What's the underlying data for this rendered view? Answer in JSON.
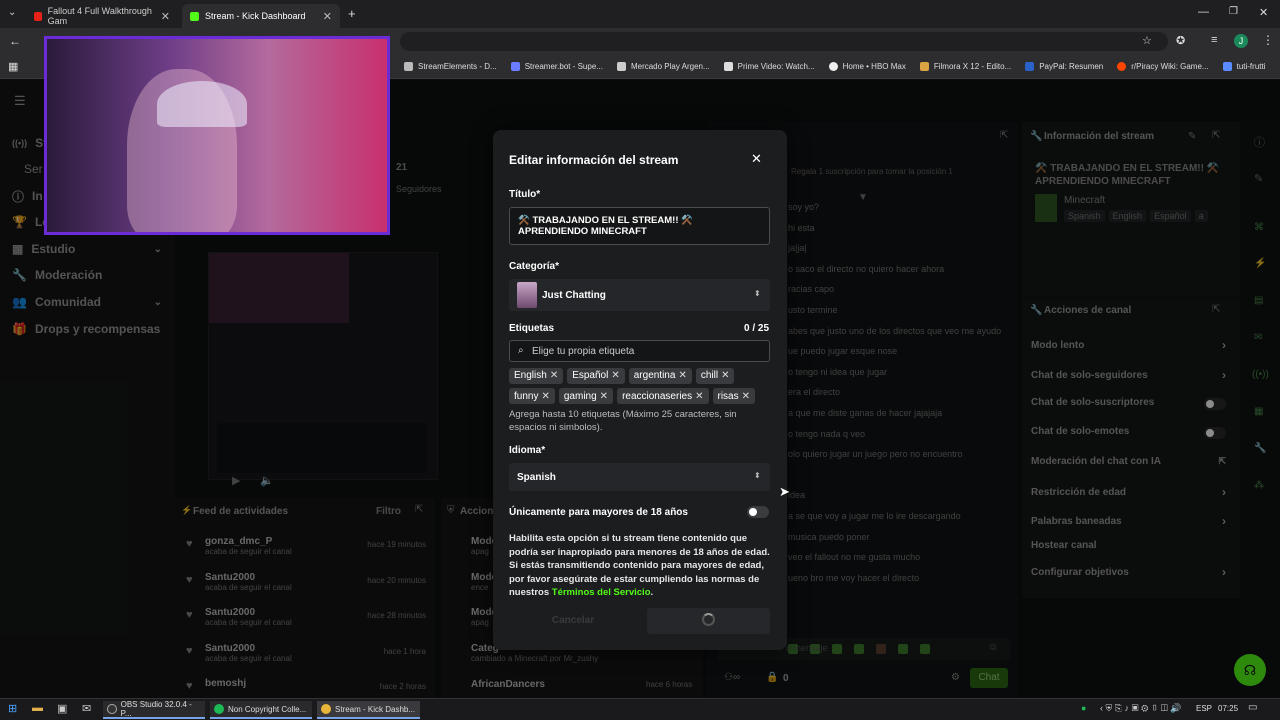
{
  "browser": {
    "tabs": [
      {
        "label": "Fallout 4 Full Walkthrough Gam"
      },
      {
        "label": "Stream - Kick Dashboard"
      }
    ],
    "bookmarks": [
      "StreamElements - D...",
      "Streamer.bot - Supe...",
      "Mercado Play Argen...",
      "Prime Video: Watch...",
      "Home • HBO Max",
      "Filmora X 12 - Edito...",
      "PayPal: Resumen",
      "r/Piracy Wiki: Game...",
      "tuti-frutti"
    ],
    "profile_initial": "J"
  },
  "sidebar": {
    "items": [
      {
        "label": "St",
        "icon": "stream-icon"
      },
      {
        "label": "Ser",
        "icon": ""
      },
      {
        "label": "In",
        "icon": "info-icon"
      },
      {
        "label": "Le",
        "icon": "trophy-icon"
      },
      {
        "label": "Estudio",
        "icon": "grid-icon",
        "has_chevron": true
      },
      {
        "label": "Moderación",
        "icon": "wrench-icon"
      },
      {
        "label": "Comunidad",
        "icon": "people-icon",
        "has_chevron": true
      },
      {
        "label": "Drops y recompensas",
        "icon": "gift-icon"
      }
    ]
  },
  "stats": {
    "number": "21",
    "label": "Seguidores"
  },
  "activity_feed": {
    "title": "Feed de actividades",
    "filter": "Filtro",
    "items": [
      {
        "name": "gonza_dmc_P",
        "sub": "acaba de seguir el canal",
        "time": "hace 19 minutos"
      },
      {
        "name": "Santu2000",
        "sub": "acaba de seguir el canal",
        "time": "hace 20 minutos"
      },
      {
        "name": "Santu2000",
        "sub": "acaba de seguir el canal",
        "time": "hace 28 minutos"
      },
      {
        "name": "Santu2000",
        "sub": "acaba de seguir el canal",
        "time": "hace 1 hora"
      },
      {
        "name": "bemoshj",
        "sub": "",
        "time": "hace 2 horas"
      }
    ]
  },
  "actions_feed": {
    "title": "Accion",
    "items": [
      {
        "name": "Mode",
        "sub": "apag"
      },
      {
        "name": "Mode",
        "sub": "ence"
      },
      {
        "name": "Mode",
        "sub": "apag"
      },
      {
        "name": "Categ",
        "sub": "cambiado a Minecraft por Mr_zushy"
      },
      {
        "name": "AfricanDancers",
        "sub": "",
        "time": "hace 6 horas"
      }
    ]
  },
  "chat": {
    "sub_banner": "Regala 1 suscripción para tomar la posición 1",
    "messages": [
      "soy yo?",
      "hi esta",
      "ja|ja|",
      "o saco el directo no quiero hacer ahora",
      "racias capo",
      "usto termine",
      "abes que justo uno de los directos que veo me ayudo",
      "ue puedo jugar esque nose",
      "o tengo ni idea que jugar",
      "era el directo",
      "a que me diste ganas de hacer jajajaja",
      "o tengo nada q veo",
      "olo quiero jugar un juego pero no encuentro",
      "",
      "idea",
      "a se que voy a jugar me lo ire descargando",
      "musica puedo poner",
      "veo el fallout no me gusta mucho",
      "ueno bro me voy hacer el directo"
    ],
    "input_placeholder": "n mensaje",
    "count": "0",
    "send_label": "Chat"
  },
  "stream_info": {
    "title": "Información del stream",
    "stream_title": "⚒️ TRABAJANDO EN EL STREAM!! ⚒️ APRENDIENDO MINECRAFT",
    "category": "Minecraft",
    "tags": [
      "Spanish",
      "English",
      "Español",
      "a"
    ]
  },
  "channel_actions": {
    "title": "Acciones de canal",
    "items": [
      {
        "label": "Modo lento",
        "control": "chevron"
      },
      {
        "label": "Chat de solo-seguidores",
        "control": "chevron"
      },
      {
        "label": "Chat de solo-suscriptores",
        "control": "toggle"
      },
      {
        "label": "Chat de solo-emotes",
        "control": "toggle"
      },
      {
        "label": "Moderación del chat con IA",
        "control": "external"
      },
      {
        "label": "Restricción de edad",
        "control": "chevron"
      },
      {
        "label": "Palabras baneadas",
        "control": "chevron"
      },
      {
        "label": "Hostear canal",
        "control": "none"
      },
      {
        "label": "Configurar objetivos",
        "control": "chevron"
      }
    ]
  },
  "modal": {
    "title": "Editar información del stream",
    "title_label": "Título*",
    "title_value": "⚒️ TRABAJANDO EN EL STREAM!! ⚒️ APRENDIENDO MINECRAFT",
    "category_label": "Categoría*",
    "category_value": "Just Chatting",
    "tags_label": "Etiquetas",
    "tags_count": "0 / 25",
    "tags_placeholder": "Elige tu propia etiqueta",
    "tags": [
      "English",
      "Español",
      "argentina",
      "chill",
      "funny",
      "gaming",
      "reaccionaseries",
      "risas"
    ],
    "tags_help": "Agrega hasta 10 etiquetas (Máximo 25 caracteres, sin espacios ni simbolos).",
    "language_label": "Idioma*",
    "language_value": "Spanish",
    "adult_label": "Únicamente para mayores de 18 años",
    "adult_help": "Habilita esta opción si tu stream tiene contenido que podría ser inapropiado para menores de 18 años de edad. Si estás transmitiendo contenido para mayores de edad, por favor asegúrate de estar cumpliendo las normas de nuestros",
    "terms_link": "Términos del Servicio",
    "terms_end": ".",
    "cancel_label": "Cancelar"
  },
  "taskbar": {
    "apps": [
      {
        "label": "OBS Studio 32.0.4 - P..."
      },
      {
        "label": "Non Copyright Colle..."
      },
      {
        "label": "Stream - Kick Dashb..."
      }
    ],
    "lang": "ESP",
    "time": "07:25"
  },
  "colors": {
    "accent": "#53fc18",
    "webcam_border": "#6b2bd6"
  }
}
